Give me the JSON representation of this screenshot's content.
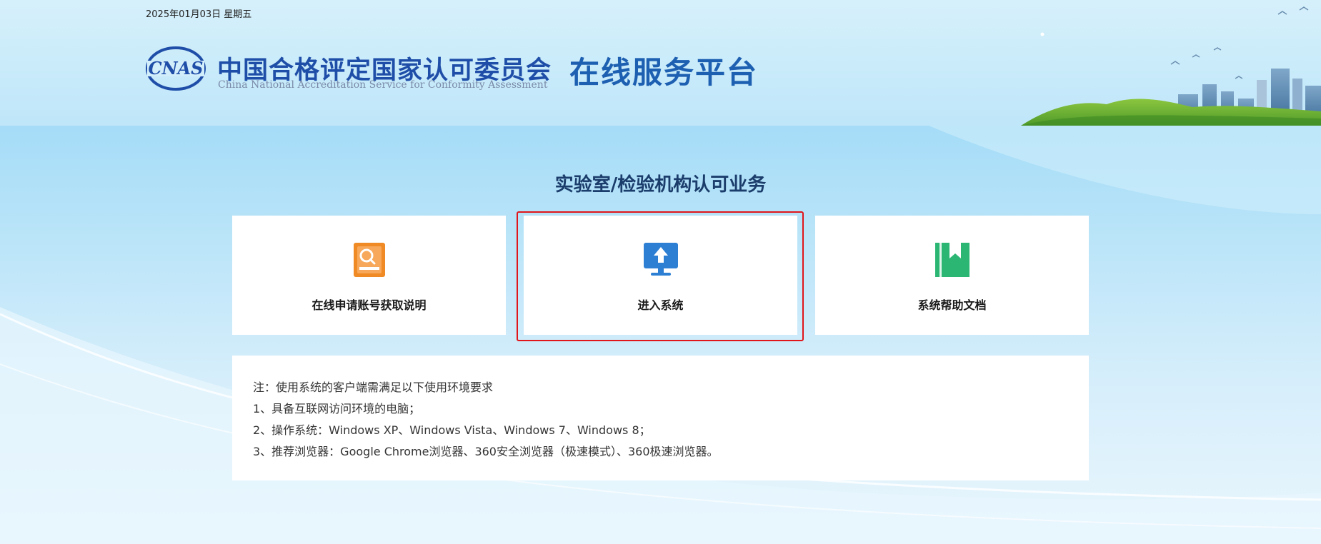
{
  "header": {
    "date": "2025年01月03日 星期五",
    "logo_mark_text": "CNAS",
    "org_name_cn": "中国合格评定国家认可委员会",
    "org_name_en": "China National Accreditation Service for Conformity Assessment",
    "platform_title": "在线服务平台"
  },
  "main": {
    "section_title": "实验室/检验机构认可业务",
    "cards": [
      {
        "label": "在线申请账号获取说明",
        "icon": "account-guide-icon",
        "color": "#f08a24"
      },
      {
        "label": "进入系统",
        "icon": "enter-system-icon",
        "color": "#2d7fd3"
      },
      {
        "label": "系统帮助文档",
        "icon": "help-doc-icon",
        "color": "#2bb673"
      }
    ],
    "notes": [
      "注：使用系统的客户端需满足以下使用环境要求",
      "1、具备互联网访问环境的电脑；",
      "2、操作系统：Windows XP、Windows Vista、Windows 7、Windows 8；",
      "3、推荐浏览器：Google Chrome浏览器、360安全浏览器（极速模式）、360极速浏览器。"
    ]
  },
  "colors": {
    "brand_blue": "#1f4ea8",
    "title_blue": "#1d5fb1",
    "highlight_red": "#e0161b",
    "background_sky": "#b4e2f8"
  }
}
